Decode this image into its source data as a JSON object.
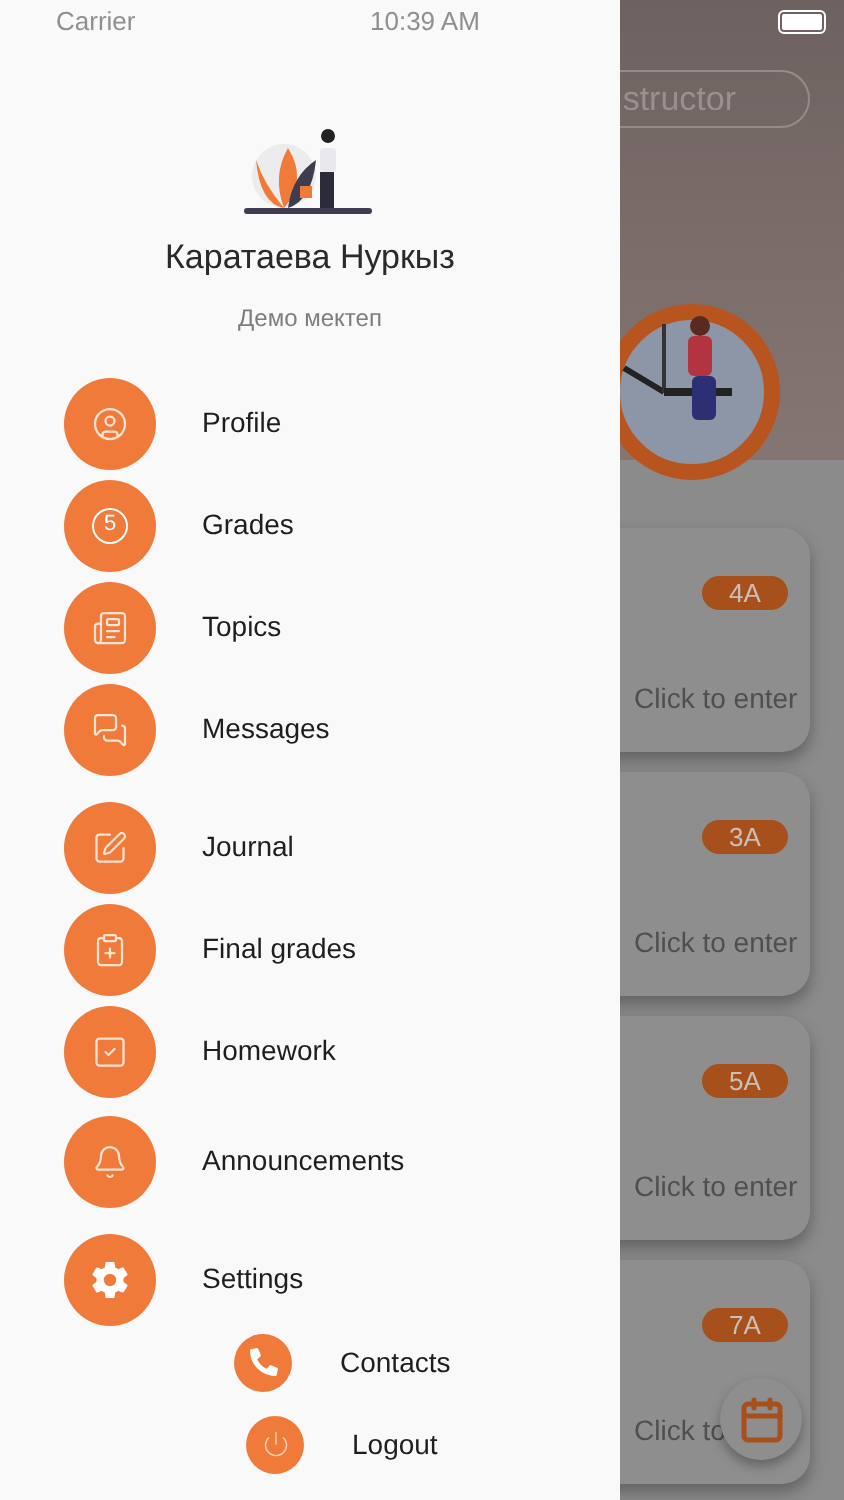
{
  "status_bar": {
    "carrier": "Carrier",
    "time": "10:39 AM"
  },
  "drawer": {
    "user_name": "Каратаева Нуркыз",
    "school": "Демо мектеп",
    "menu": [
      {
        "label": "Profile"
      },
      {
        "label": "Grades",
        "icon_text": "5"
      },
      {
        "label": "Topics"
      },
      {
        "label": "Messages"
      },
      {
        "label": "Journal"
      },
      {
        "label": "Final grades"
      },
      {
        "label": "Homework"
      },
      {
        "label": "Announcements"
      },
      {
        "label": "Settings"
      }
    ],
    "footer": [
      {
        "label": "Contacts"
      },
      {
        "label": "Logout"
      }
    ]
  },
  "background": {
    "search": {
      "value": "structor"
    },
    "classes": [
      {
        "badge": "4A",
        "action": "Click to enter"
      },
      {
        "badge": "3A",
        "action": "Click to enter"
      },
      {
        "badge": "5A",
        "action": "Click to enter"
      },
      {
        "badge": "7A",
        "action": "Click to"
      }
    ]
  }
}
